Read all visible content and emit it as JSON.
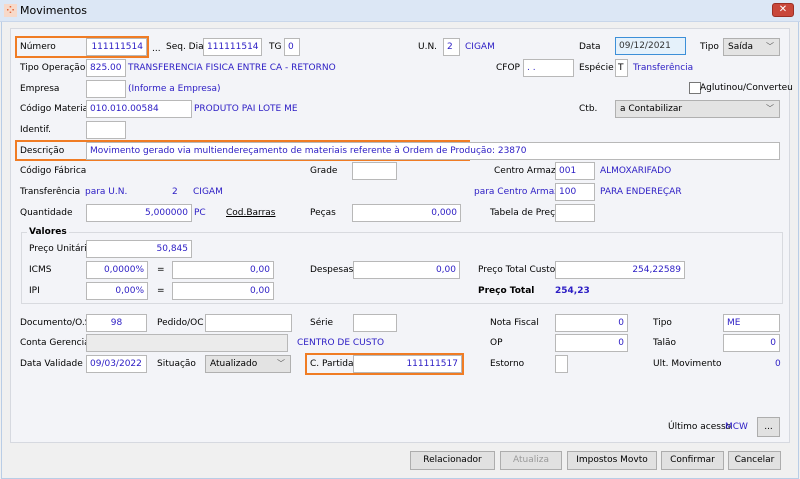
{
  "window": {
    "title": "Movimentos",
    "close_label": "✕"
  },
  "header": {
    "numero_label": "Número",
    "numero": "111111514",
    "ellipsis": "...",
    "seq_dia_label": "Seq. Dia",
    "seq_dia": "111111514",
    "tg_label": "TG",
    "tg": "0",
    "un_label": "U.N.",
    "un": "2",
    "un_name": "CIGAM",
    "data_label": "Data",
    "data": "09/12/2021",
    "tipo_label": "Tipo",
    "tipo": "Saída",
    "tipo_operacao_label": "Tipo Operação",
    "tipo_operacao": "825.00",
    "tipo_operacao_desc": "TRANSFERENCIA FISICA ENTRE CA - RETORNO",
    "cfop_label": "CFOP",
    "cfop": ". .",
    "especie_label": "Espécie",
    "especie": "T",
    "especie_desc": "Transferência",
    "empresa_label": "Empresa",
    "empresa": "",
    "empresa_hint": "(Informe a Empresa)",
    "aglutinou_label": "Aglutinou/Converteu",
    "codigo_material_label": "Código Material",
    "codigo_material": "010.010.00584",
    "material_desc": "PRODUTO PAI LOTE ME",
    "ctb_label": "Ctb.",
    "ctb": "a Contabilizar",
    "identif_label": "Identif.",
    "descricao_label": "Descrição",
    "descricao": "Movimento gerado via multiendereçamento de materiais referente à Ordem de Produção: 23870"
  },
  "middle": {
    "codigo_fabrica_label": "Código Fábrica",
    "grade_label": "Grade",
    "centro_armaz_label": "Centro Armaz.",
    "centro_armaz": "001",
    "centro_armaz_desc": "ALMOXARIFADO",
    "transferencia_label": "Transferência",
    "para_un_label": "para U.N.",
    "para_un": "2",
    "para_un_name": "CIGAM",
    "para_centro_label": "para Centro Armaz.",
    "para_centro": "100",
    "para_centro_desc": "PARA ENDEREÇAR",
    "quantidade_label": "Quantidade",
    "quantidade": "5,000000",
    "unidade": "PC",
    "cod_barras": "Cod.Barras",
    "pecas_label": "Peças",
    "pecas": "0,000",
    "tabela_preco_label": "Tabela de Preço"
  },
  "valores": {
    "title": "Valores",
    "preco_unitario_label": "Preço Unitário",
    "preco_unitario": "50,845",
    "icms_label": "ICMS",
    "icms_pct": "0,0000%",
    "icms_val": "0,00",
    "eq": "=",
    "ipi_label": "IPI",
    "ipi_pct": "0,00%",
    "ipi_val": "0,00",
    "despesas_label": "Despesas",
    "despesas": "0,00",
    "preco_total_custo_label": "Preço Total Custo",
    "preco_total_custo": "254,22589",
    "preco_total_label": "Preço Total",
    "preco_total": "254,23"
  },
  "bottom": {
    "documento_label": "Documento/O.S",
    "documento": "98",
    "pedido_label": "Pedido/OC",
    "serie_label": "Série",
    "nota_fiscal_label": "Nota Fiscal",
    "nota_fiscal": "0",
    "tipo_label": "Tipo",
    "tipo": "ME",
    "conta_gerencial_label": "Conta Gerencial",
    "centro_custo": "CENTRO DE CUSTO",
    "op_label": "OP",
    "op": "0",
    "talao_label": "Talão",
    "talao": "0",
    "data_validade_label": "Data Validade",
    "data_validade": "09/03/2022",
    "situacao_label": "Situação",
    "situacao": "Atualizado",
    "c_partida_label": "C. Partida",
    "c_partida": "111111517",
    "estorno_label": "Estorno",
    "ult_movimento_label": "Ult. Movimento",
    "ult_movimento": "0",
    "ultimo_acesso_label": "Último acesso",
    "ultimo_acesso": "MCW",
    "more": "..."
  },
  "buttons": {
    "relacionador": "Relacionador",
    "atualiza": "Atualiza",
    "impostos": "Impostos Movto",
    "confirmar": "Confirmar",
    "cancelar": "Cancelar"
  },
  "colors": {
    "accent": "#f07c24",
    "value": "#2b1cc4"
  }
}
